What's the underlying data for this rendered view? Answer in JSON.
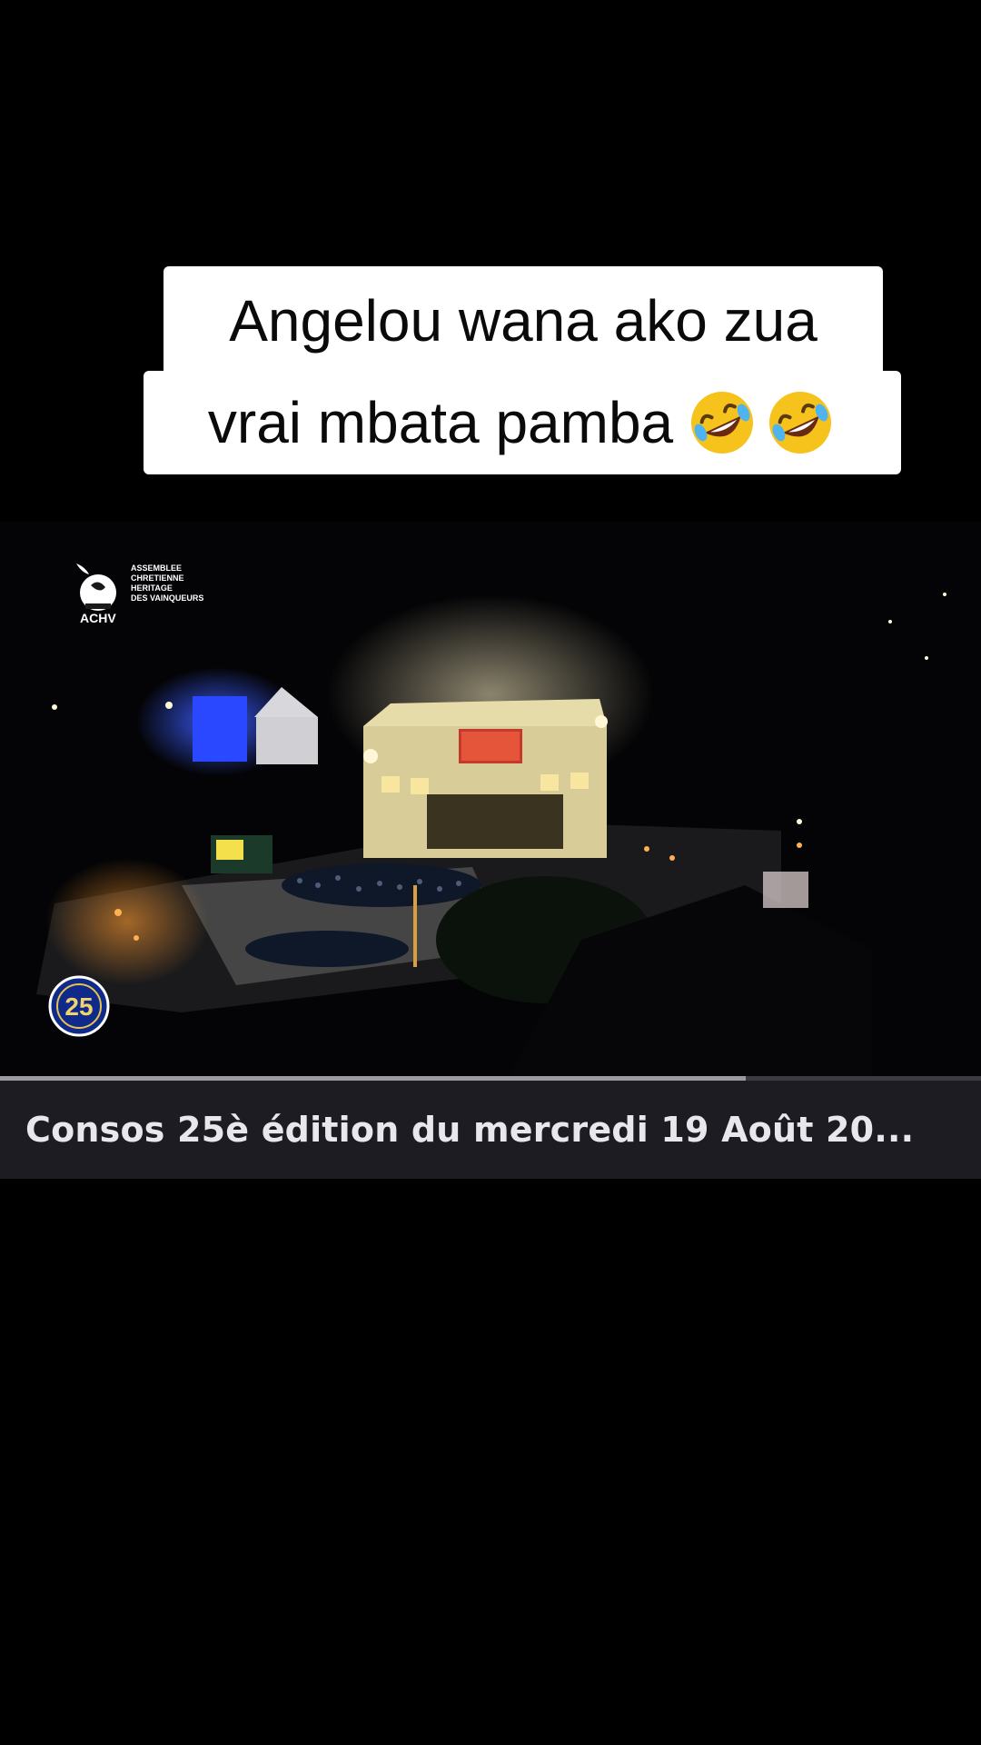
{
  "caption": {
    "line1": "Angelou wana ako zua",
    "line2": "vrai mbata pamba",
    "emojis": [
      "rolling-on-floor-laughing",
      "rolling-on-floor-laughing"
    ]
  },
  "video": {
    "logo": {
      "abbr": "ACHV",
      "lines": [
        "ASSEMBLEE",
        "CHRETIENNE",
        "HERITAGE",
        "DES VAINQUEURS"
      ]
    },
    "badge": {
      "number": "25"
    },
    "progress_percent": 76
  },
  "subtitle": {
    "text": "Consos 25è édition du mercredi 19 Août  20..."
  }
}
